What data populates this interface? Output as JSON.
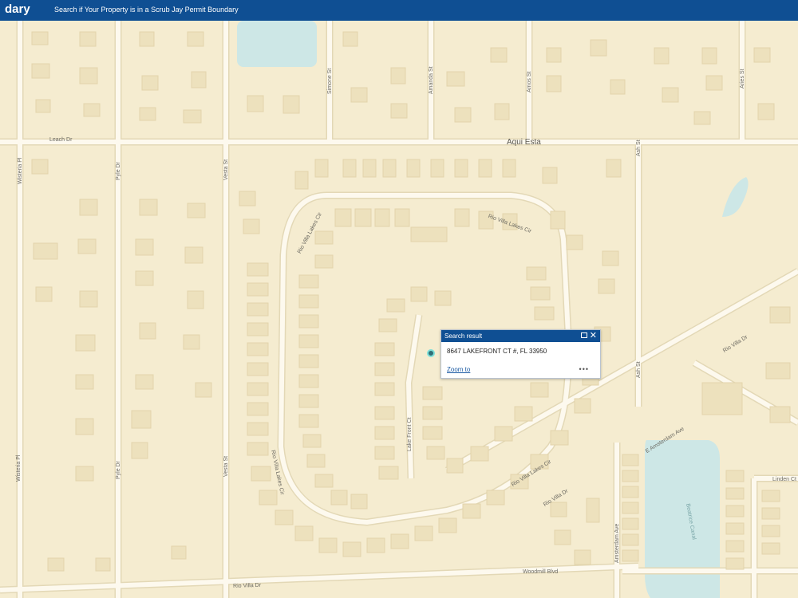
{
  "header": {
    "title_fragment": "dary",
    "subtitle": "Search if Your Property is in a Scrub Jay Permit Boundary"
  },
  "popup": {
    "title": "Search result",
    "address": "8647 LAKEFRONT CT #, FL 33950",
    "zoom_link": "Zoom to",
    "more": "•••"
  },
  "map": {
    "streets": {
      "leach_dr": "Leach Dr",
      "aqui_esta": "Aqui Esta",
      "rio_villa_lakes_cir": "Rio Villa Lakes Cir",
      "rio_villa_lakes_cir_2": "Rio Villa Lakes Cir",
      "rio_villa_lakes_cir_3": "Rio Villa Lakes Cir",
      "rio_villa_dr": "Rio Villa Dr",
      "rio_villa_dr_2": "Rio Villa Dr",
      "rio_villa_dr_3": "Rio Villa Dr",
      "lake_front_ct": "Lake Front Ct",
      "e_amsterdam_ave": "E Amsterdam Ave",
      "amsterdam_ave": "Amsterdam Ave",
      "woodmill_blvd": "Woodmill Blvd",
      "linden_ct": "Linden Ct",
      "wisteria_pl": "Wisteria Pl",
      "wisteria_pl_2": "Wisteria Pl",
      "pyle_dr": "Pyle Dr",
      "pyle_dr_2": "Pyle Dr",
      "sesta_st": "Vesta St",
      "vesta_st_2": "Vesta St",
      "simone_st": "Simone St",
      "amanda_st": "Amanda St",
      "amos_st": "Amos St",
      "aries_st": "Aries St",
      "ash_st": "Ash St",
      "ash_st_2": "Ash St",
      "beatrice_canal": "Beatrice Canal"
    },
    "colors": {
      "land": "#f5ecd0",
      "road": "#fdf9ee",
      "road_edge": "#e6dcbc",
      "building": "#ede1bd",
      "water": "#cde7e6",
      "header": "#0f4f93"
    },
    "marker": "location-pin"
  }
}
